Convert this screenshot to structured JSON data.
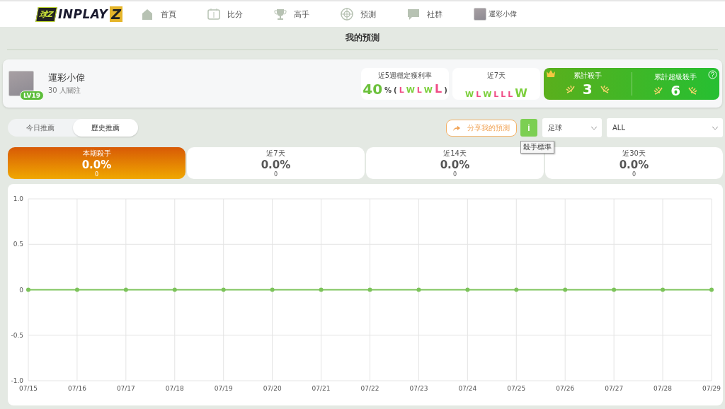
{
  "header": {
    "logo_badge": "球Z",
    "logo_text": "INPLAY",
    "logo_z": "Z",
    "nav": [
      {
        "label": "首頁",
        "kind": "home"
      },
      {
        "label": "比分",
        "kind": "score"
      },
      {
        "label": "高手",
        "kind": "trophy"
      },
      {
        "label": "預測",
        "kind": "target"
      },
      {
        "label": "社群",
        "kind": "chat"
      }
    ],
    "user": "運彩小偉"
  },
  "page_title": "我的預測",
  "profile": {
    "name": "運彩小偉",
    "followers": "30 人關注",
    "level": "LV19",
    "stable": {
      "label": "近5週穩定獲利率",
      "value": "40",
      "unit": "%",
      "open": "(",
      "close": ")",
      "results": [
        {
          "letter": "L",
          "win": false,
          "latest": false
        },
        {
          "letter": "W",
          "win": true,
          "latest": false
        },
        {
          "letter": "L",
          "win": false,
          "latest": false
        },
        {
          "letter": "W",
          "win": true,
          "latest": false
        },
        {
          "letter": "L",
          "win": false,
          "latest": true
        }
      ]
    },
    "week": {
      "label": "近7天",
      "results": [
        {
          "letter": "W",
          "win": true,
          "latest": false
        },
        {
          "letter": "L",
          "win": false,
          "latest": false
        },
        {
          "letter": "W",
          "win": true,
          "latest": false
        },
        {
          "letter": "L",
          "win": false,
          "latest": false
        },
        {
          "letter": "L",
          "win": false,
          "latest": false
        },
        {
          "letter": "L",
          "win": false,
          "latest": false
        },
        {
          "letter": "W",
          "win": true,
          "latest": true
        }
      ]
    },
    "killers": [
      {
        "label": "累計殺手",
        "value": "3"
      },
      {
        "label": "累計超級殺手",
        "value": "6"
      }
    ]
  },
  "tabs": [
    {
      "label": "今日推薦",
      "selected": false
    },
    {
      "label": "歷史推薦",
      "selected": true
    }
  ],
  "share_button": "分享我的預測",
  "info_button": "i",
  "info_tooltip": "殺手標準",
  "selects": [
    {
      "value": "足球"
    },
    {
      "value": "ALL"
    }
  ],
  "periods": [
    {
      "label": "本期殺手",
      "value": "0.0%",
      "count": "0",
      "selected": true
    },
    {
      "label": "近7天",
      "value": "0.0%",
      "count": "0",
      "selected": false
    },
    {
      "label": "近14天",
      "value": "0.0%",
      "count": "0",
      "selected": false
    },
    {
      "label": "近30天",
      "value": "0.0%",
      "count": "0",
      "selected": false
    }
  ],
  "chart_data": {
    "type": "line",
    "categories": [
      "07/15",
      "07/16",
      "07/17",
      "07/18",
      "07/19",
      "07/20",
      "07/21",
      "07/22",
      "07/23",
      "07/24",
      "07/25",
      "07/26",
      "07/27",
      "07/28",
      "07/29"
    ],
    "grid": true,
    "series": [
      {
        "color": "#7cc35a",
        "marker": true,
        "values": [
          0,
          0,
          0,
          0,
          0,
          0,
          0,
          0,
          0,
          0,
          0,
          0,
          0,
          0,
          0
        ]
      }
    ],
    "ylim": [
      -1,
      1
    ],
    "yticks": [
      {
        "value": 1,
        "label": "1.0"
      },
      {
        "value": 0.5,
        "label": "0.5"
      },
      {
        "value": 0,
        "label": "0"
      },
      {
        "value": -0.5,
        "label": "-0.5"
      },
      {
        "value": -1,
        "label": "-1.0"
      }
    ]
  }
}
